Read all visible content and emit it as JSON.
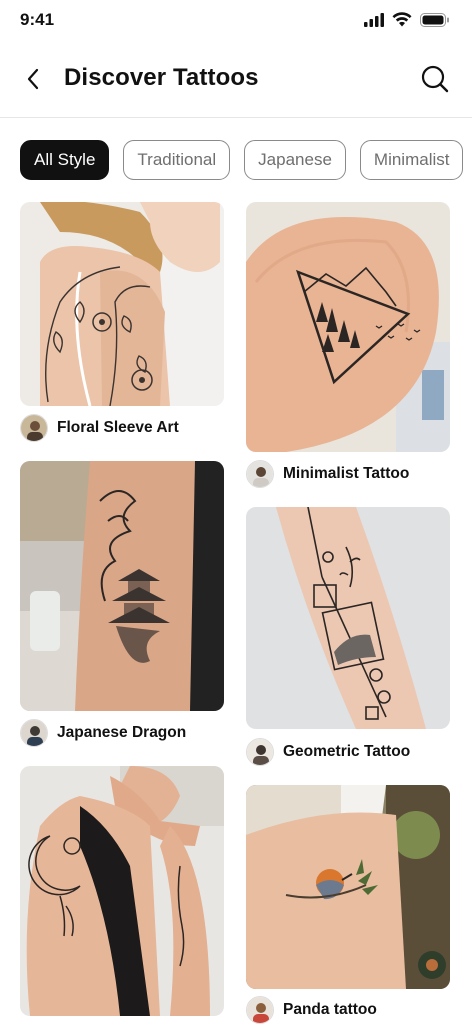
{
  "status": {
    "time": "9:41"
  },
  "header": {
    "title": "Discover Tattoos"
  },
  "filters": [
    {
      "label": "All Style",
      "active": true
    },
    {
      "label": "Traditional",
      "active": false
    },
    {
      "label": "Japanese",
      "active": false
    },
    {
      "label": "Minimalist",
      "active": false
    }
  ],
  "cards": [
    {
      "title": "Floral Sleeve Art"
    },
    {
      "title": "Minimalist Tattoo"
    },
    {
      "title": "Japanese Dragon"
    },
    {
      "title": "Geometric Tattoo"
    },
    {
      "title": ""
    },
    {
      "title": "Panda tattoo"
    }
  ],
  "colors": {
    "accent": "#111111",
    "chip_border": "#8a8a8a",
    "chip_text": "#6f6f6f"
  }
}
